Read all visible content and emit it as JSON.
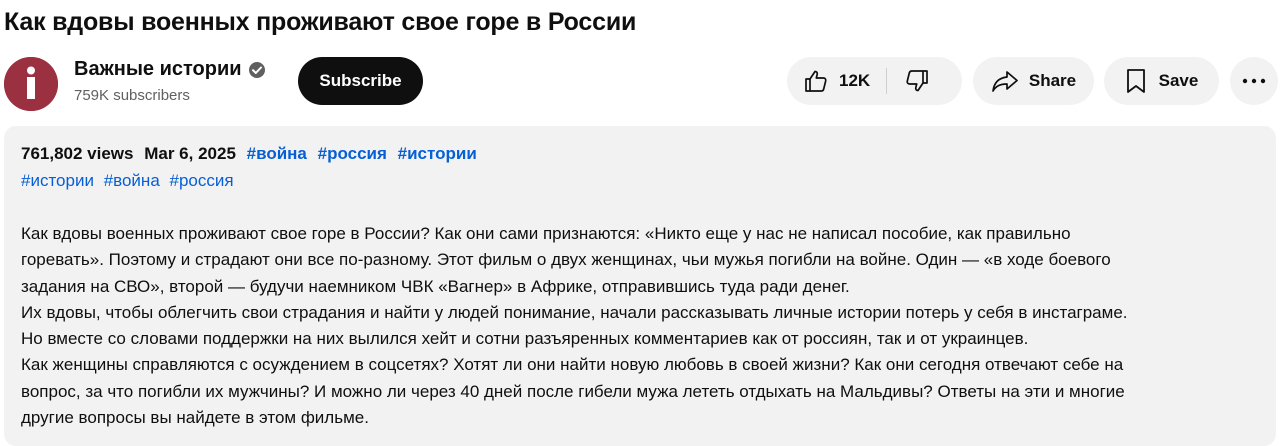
{
  "video": {
    "title": "Как вдовы военных проживают свое горе в России"
  },
  "channel": {
    "name": "Важные истории",
    "subscribers": "759K subscribers",
    "avatar_icon": "info-i-icon",
    "avatar_color": "#9b3040",
    "verified_icon": "verified-check-icon"
  },
  "actions": {
    "subscribe_label": "Subscribe",
    "like_count": "12K",
    "like_icon": "thumbs-up-icon",
    "dislike_icon": "thumbs-down-icon",
    "share_label": "Share",
    "share_icon": "share-arrow-icon",
    "save_label": "Save",
    "save_icon": "bookmark-icon",
    "more_icon": "more-horizontal-icon"
  },
  "description": {
    "views": "761,802 views",
    "date": "Mar 6, 2025",
    "tags_line1": [
      "#война",
      "#россия",
      "#истории"
    ],
    "tags_line2": [
      "#истории",
      "#война",
      "#россия"
    ],
    "hashtag_color": "#065fd4",
    "lines": [
      "Как вдовы военных проживают свое горе в России? Как они сами признаются: «Никто еще у нас не написал пособие, как правильно",
      "горевать». Поэтому и страдают они все по-разному. Этот фильм о двух женщинах, чьи мужья погибли на войне. Один — «в ходе боевого",
      "задания на СВО», второй — будучи наемником ЧВК «Вагнер» в Африке, отправившись туда ради денег.",
      "Их вдовы, чтобы облегчить свои страдания и найти у людей понимание, начали рассказывать личные истории потерь у себя в инстаграме.",
      "Но вместе со словами поддержки на них вылился хейт и сотни разъяренных комментариев как от россиян, так и от украинцев.",
      "Как женщины справляются с осуждением в соцсетях? Хотят ли они найти новую любовь в своей жизни? Как они сегодня отвечают себе на",
      "вопрос, за что погибли их мужчины? И можно ли через 40 дней после гибели мужа лететь отдыхать на Мальдивы? Ответы на эти и многие",
      "другие вопросы вы найдете в этом фильме."
    ]
  }
}
